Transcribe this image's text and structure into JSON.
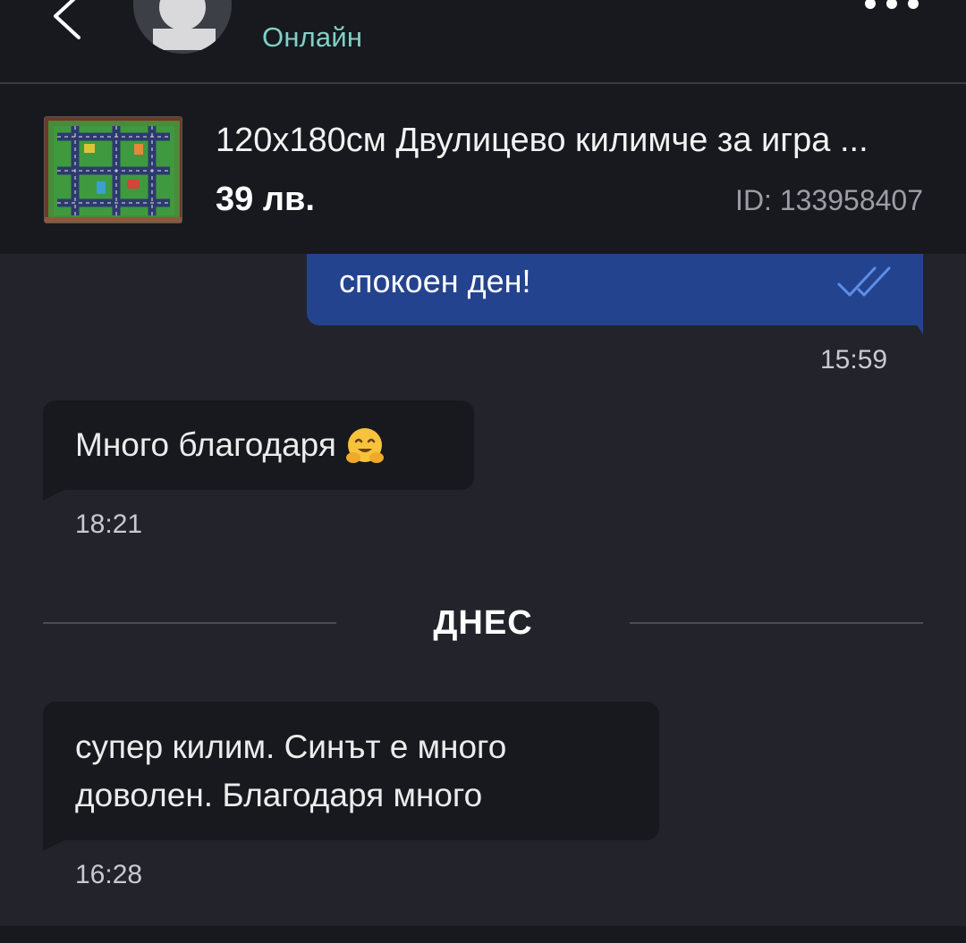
{
  "header": {
    "status": "Онлайн",
    "back_icon": "chevron-left-icon",
    "more_icon": "more-dots-icon"
  },
  "product": {
    "title": "120x180см Двулицево килимче за игра ...",
    "price": "39 лв.",
    "id": "ID: 133958407"
  },
  "messages": [
    {
      "direction": "out",
      "text": "спокоен ден!",
      "time": "15:59",
      "status_icon": "double-check-icon"
    },
    {
      "direction": "in",
      "text": "Много благодаря",
      "emoji": "hugging-face-emoji",
      "time": "18:21"
    },
    {
      "direction": "in",
      "text": "супер килим. Синът е много доволен. Благодаря много",
      "time": "16:28"
    }
  ],
  "date_separator": "ДНЕС",
  "colors": {
    "background": "#23242b",
    "header": "#17191f",
    "outgoing_bubble": "#24438f",
    "incoming_bubble": "#17191f",
    "status_online": "#7fd1c6"
  }
}
